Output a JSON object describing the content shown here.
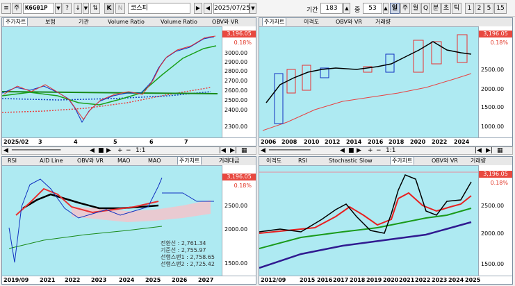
{
  "toolbar": {
    "menu_glyph": "≡",
    "market_tab": "주",
    "code": "K6G01P",
    "code_tag": "?",
    "glyph_a": "↓",
    "glyph_b": "⇅",
    "k_label": "K",
    "n_label": "N",
    "name": "코스피",
    "date": "2025/07/25",
    "period_label": "기간",
    "period_value": "183",
    "count_label": "중",
    "count_value": "53",
    "period_buttons": [
      "일",
      "주",
      "월",
      "Q",
      "분",
      "초",
      "틱",
      "1",
      "2",
      "5",
      "15"
    ]
  },
  "panes": {
    "tl": {
      "tabs": [
        "주가차트",
        "보험",
        "기관",
        "Volume Ratio",
        "Volume Ratio",
        "OBV와 VR"
      ],
      "y_labels": [
        "3000.00",
        "2900.00",
        "2800.00",
        "2700.00",
        "2600.00",
        "2500.00",
        "2400.00",
        "2300.00"
      ],
      "x_labels": [
        "2025/02",
        "3",
        "4",
        "5",
        "6",
        "7"
      ],
      "price": "3,196.05",
      "pct": "0.18%"
    },
    "tr": {
      "tabs": [
        "주가차트",
        "이격도",
        "OBV와 VR",
        "거래량"
      ],
      "y_labels": [
        "2500.00",
        "2000.00",
        "1500.00",
        "1000.00"
      ],
      "x_labels": [
        "2006",
        "2008",
        "2010",
        "2012",
        "2014",
        "2016",
        "2018",
        "2020",
        "2022",
        "2024"
      ],
      "price": "3,196.05",
      "pct": "0.18%"
    },
    "bl": {
      "tabs": [
        "RSI",
        "A/D Line",
        "OBV와 VR",
        "MAO",
        "MAO",
        "주가차트",
        "거래대금"
      ],
      "y_labels": [
        "2500.00",
        "2000.00",
        "1500.00"
      ],
      "x_labels": [
        "2019/09",
        "2021",
        "2022",
        "2023",
        "2024",
        "2025",
        "2026",
        "2027"
      ],
      "price": "3,196.05",
      "pct": "0.18%",
      "legend": [
        {
          "name": "전환선",
          "value": ": 2,761.34"
        },
        {
          "name": "기준선",
          "value": ": 2,755.97"
        },
        {
          "name": "선행스팬1",
          "value": ": 2,758.65"
        },
        {
          "name": "선행스팬2",
          "value": ": 2,725.42"
        }
      ]
    },
    "br": {
      "tabs": [
        "이격도",
        "RSI",
        "Stochastic Slow",
        "주가차트",
        "OBV와 VR",
        "거래량"
      ],
      "y_labels": [
        "2500.00",
        "2000.00",
        "1500.00"
      ],
      "x_labels": [
        "2012/09",
        "2015",
        "2016",
        "2017",
        "2018",
        "2019",
        "2020",
        "2021",
        "2022",
        "2023",
        "2024",
        "2025"
      ],
      "price": "3,196.05",
      "pct": "0.18%"
    }
  },
  "nav": {
    "zoom_label": "1:1",
    "buttons": [
      "◀",
      "▶",
      "■",
      "◀",
      "▶",
      "+",
      "−",
      "|◀",
      "▶|",
      "◀▶",
      "▦",
      "▼"
    ]
  },
  "colors": {
    "bg": "#aeeaf2",
    "up": "#e8302a",
    "down": "#1030c0",
    "ma_short": "#000000",
    "ma_mid": "#11a01a",
    "ma_long": "#e84040"
  }
}
